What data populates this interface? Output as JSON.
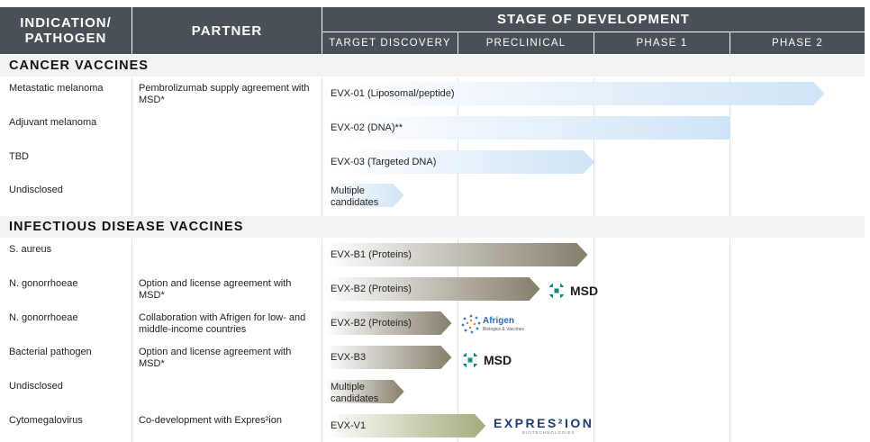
{
  "headers": {
    "indication": "INDICATION/ PATHOGEN",
    "partner": "PARTNER",
    "stage": "STAGE OF DEVELOPMENT",
    "stages": [
      "TARGET DISCOVERY",
      "PRECLINICAL",
      "PHASE 1",
      "PHASE 2"
    ]
  },
  "sections": {
    "cancer": "CANCER VACCINES",
    "infectious": "INFECTIOUS DISEASE VACCINES"
  },
  "colors": {
    "header_bg": "#4a5156",
    "cancer_bar": "#d6e9f8",
    "infectious_bar": "#8a8472",
    "cmv_bar": "#a5ad80",
    "msd_green": "#0c8a7b"
  },
  "logos": {
    "msd": "MSD",
    "afrigen": "Afrigen",
    "afrigen_sub": "Biologics & Vaccines",
    "expres2ion": "EXPRES²ION",
    "expres2ion_sub": "BIOTECHNOLOGIES"
  },
  "chart_data": {
    "type": "table",
    "stages": [
      "TARGET DISCOVERY",
      "PRECLINICAL",
      "PHASE 1",
      "PHASE 2"
    ],
    "rows": [
      {
        "section": "CANCER VACCINES",
        "indication": "Metastatic melanoma",
        "partner": "Pembrolizumab supply agreement with MSD*",
        "candidate": "EVX-01 (Liposomal/peptide)",
        "progress": 3.7
      },
      {
        "section": "CANCER VACCINES",
        "indication": "Adjuvant melanoma",
        "partner": "",
        "candidate": "EVX-02 (DNA)**",
        "progress": 3.0
      },
      {
        "section": "CANCER VACCINES",
        "indication": "TBD",
        "partner": "",
        "candidate": "EVX-03 (Targeted DNA)",
        "progress": 2.0
      },
      {
        "section": "CANCER VACCINES",
        "indication": "Undisclosed",
        "partner": "",
        "candidate": "Multiple candidates",
        "progress": 0.6
      },
      {
        "section": "INFECTIOUS DISEASE VACCINES",
        "indication": "S. aureus",
        "partner": "",
        "candidate": "EVX-B1 (Proteins)",
        "progress": 1.95
      },
      {
        "section": "INFECTIOUS DISEASE VACCINES",
        "indication": "N. gonorrhoeae",
        "partner": "Option and license agreement with MSD*",
        "candidate": "EVX-B2 (Proteins)",
        "progress": 1.6,
        "logo": "msd"
      },
      {
        "section": "INFECTIOUS DISEASE VACCINES",
        "indication": "N. gonorrhoeae",
        "partner": "Collaboration with Afrigen for low- and middle-income countries",
        "candidate": "EVX-B2 (Proteins)",
        "progress": 0.95,
        "logo": "afrigen"
      },
      {
        "section": "INFECTIOUS DISEASE VACCINES",
        "indication": "Bacterial pathogen",
        "partner": "Option and license agreement with MSD*",
        "candidate": "EVX-B3",
        "progress": 0.95,
        "logo": "msd"
      },
      {
        "section": "INFECTIOUS DISEASE VACCINES",
        "indication": "Undisclosed",
        "partner": "",
        "candidate": "Multiple candidates",
        "progress": 0.6
      },
      {
        "section": "INFECTIOUS DISEASE VACCINES",
        "indication": "Cytomegalovirus",
        "partner": "Co-development with Expres²ion",
        "candidate": "EVX-V1",
        "progress": 1.2,
        "logo": "expres2ion"
      }
    ]
  }
}
